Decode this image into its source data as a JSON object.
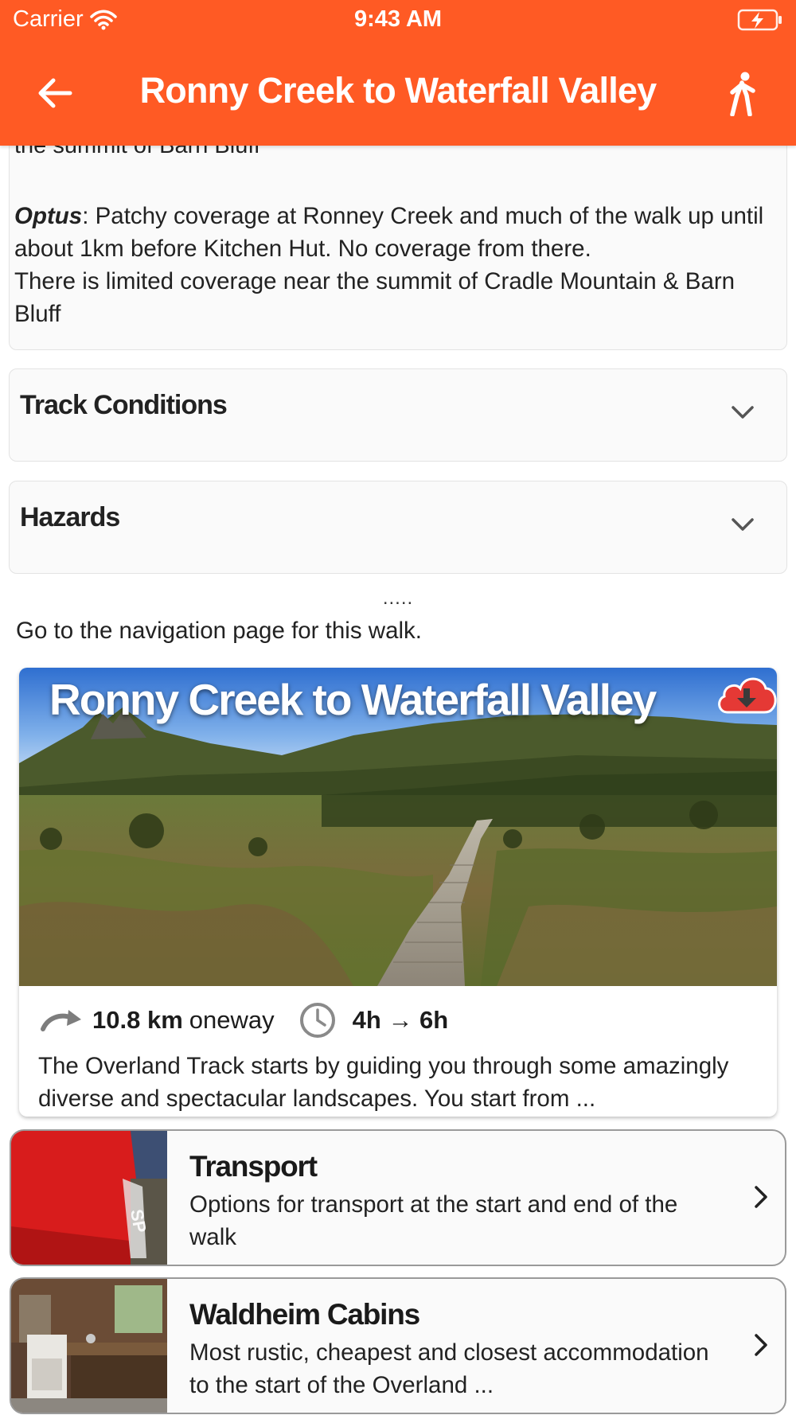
{
  "status_bar": {
    "carrier": "Carrier",
    "time": "9:43 AM"
  },
  "nav": {
    "title": "Ronny Creek to Waterfall Valley",
    "back_icon": "arrow-left-icon",
    "right_icon": "walking-person-icon"
  },
  "coverage": {
    "cut_off_line": "the summit of Barn Bluff",
    "optus_label": "Optus",
    "optus_text": ": Patchy coverage at Ronney Creek and much of the walk up until about 1km before Kitchen Hut. No coverage from there.",
    "limited_text": "There is limited coverage near the summit of Cradle Mountain & Barn Bluff"
  },
  "accordions": [
    {
      "title": "Track Conditions"
    },
    {
      "title": "Hazards"
    }
  ],
  "dots": ".....",
  "navigation_link": "Go to the navigation page for this walk.",
  "walk_card": {
    "title": "Ronny Creek to Waterfall Valley",
    "distance": "10.8 km",
    "distance_type": "oneway",
    "duration": "4h → 6h",
    "description": "The Overland Track starts by guiding you through some amazingly diverse and spectacular landscapes. You start from ..."
  },
  "list_items": [
    {
      "title": "Transport",
      "description": "Options for transport at the start and end of the walk"
    },
    {
      "title": "Waldheim Cabins",
      "description": "Most rustic, cheapest and closest accommodation to the start of the Overland ..."
    }
  ],
  "colors": {
    "header": "#ff5a24",
    "download_badge": "#e53935",
    "bus_red": "#d81c1c"
  }
}
